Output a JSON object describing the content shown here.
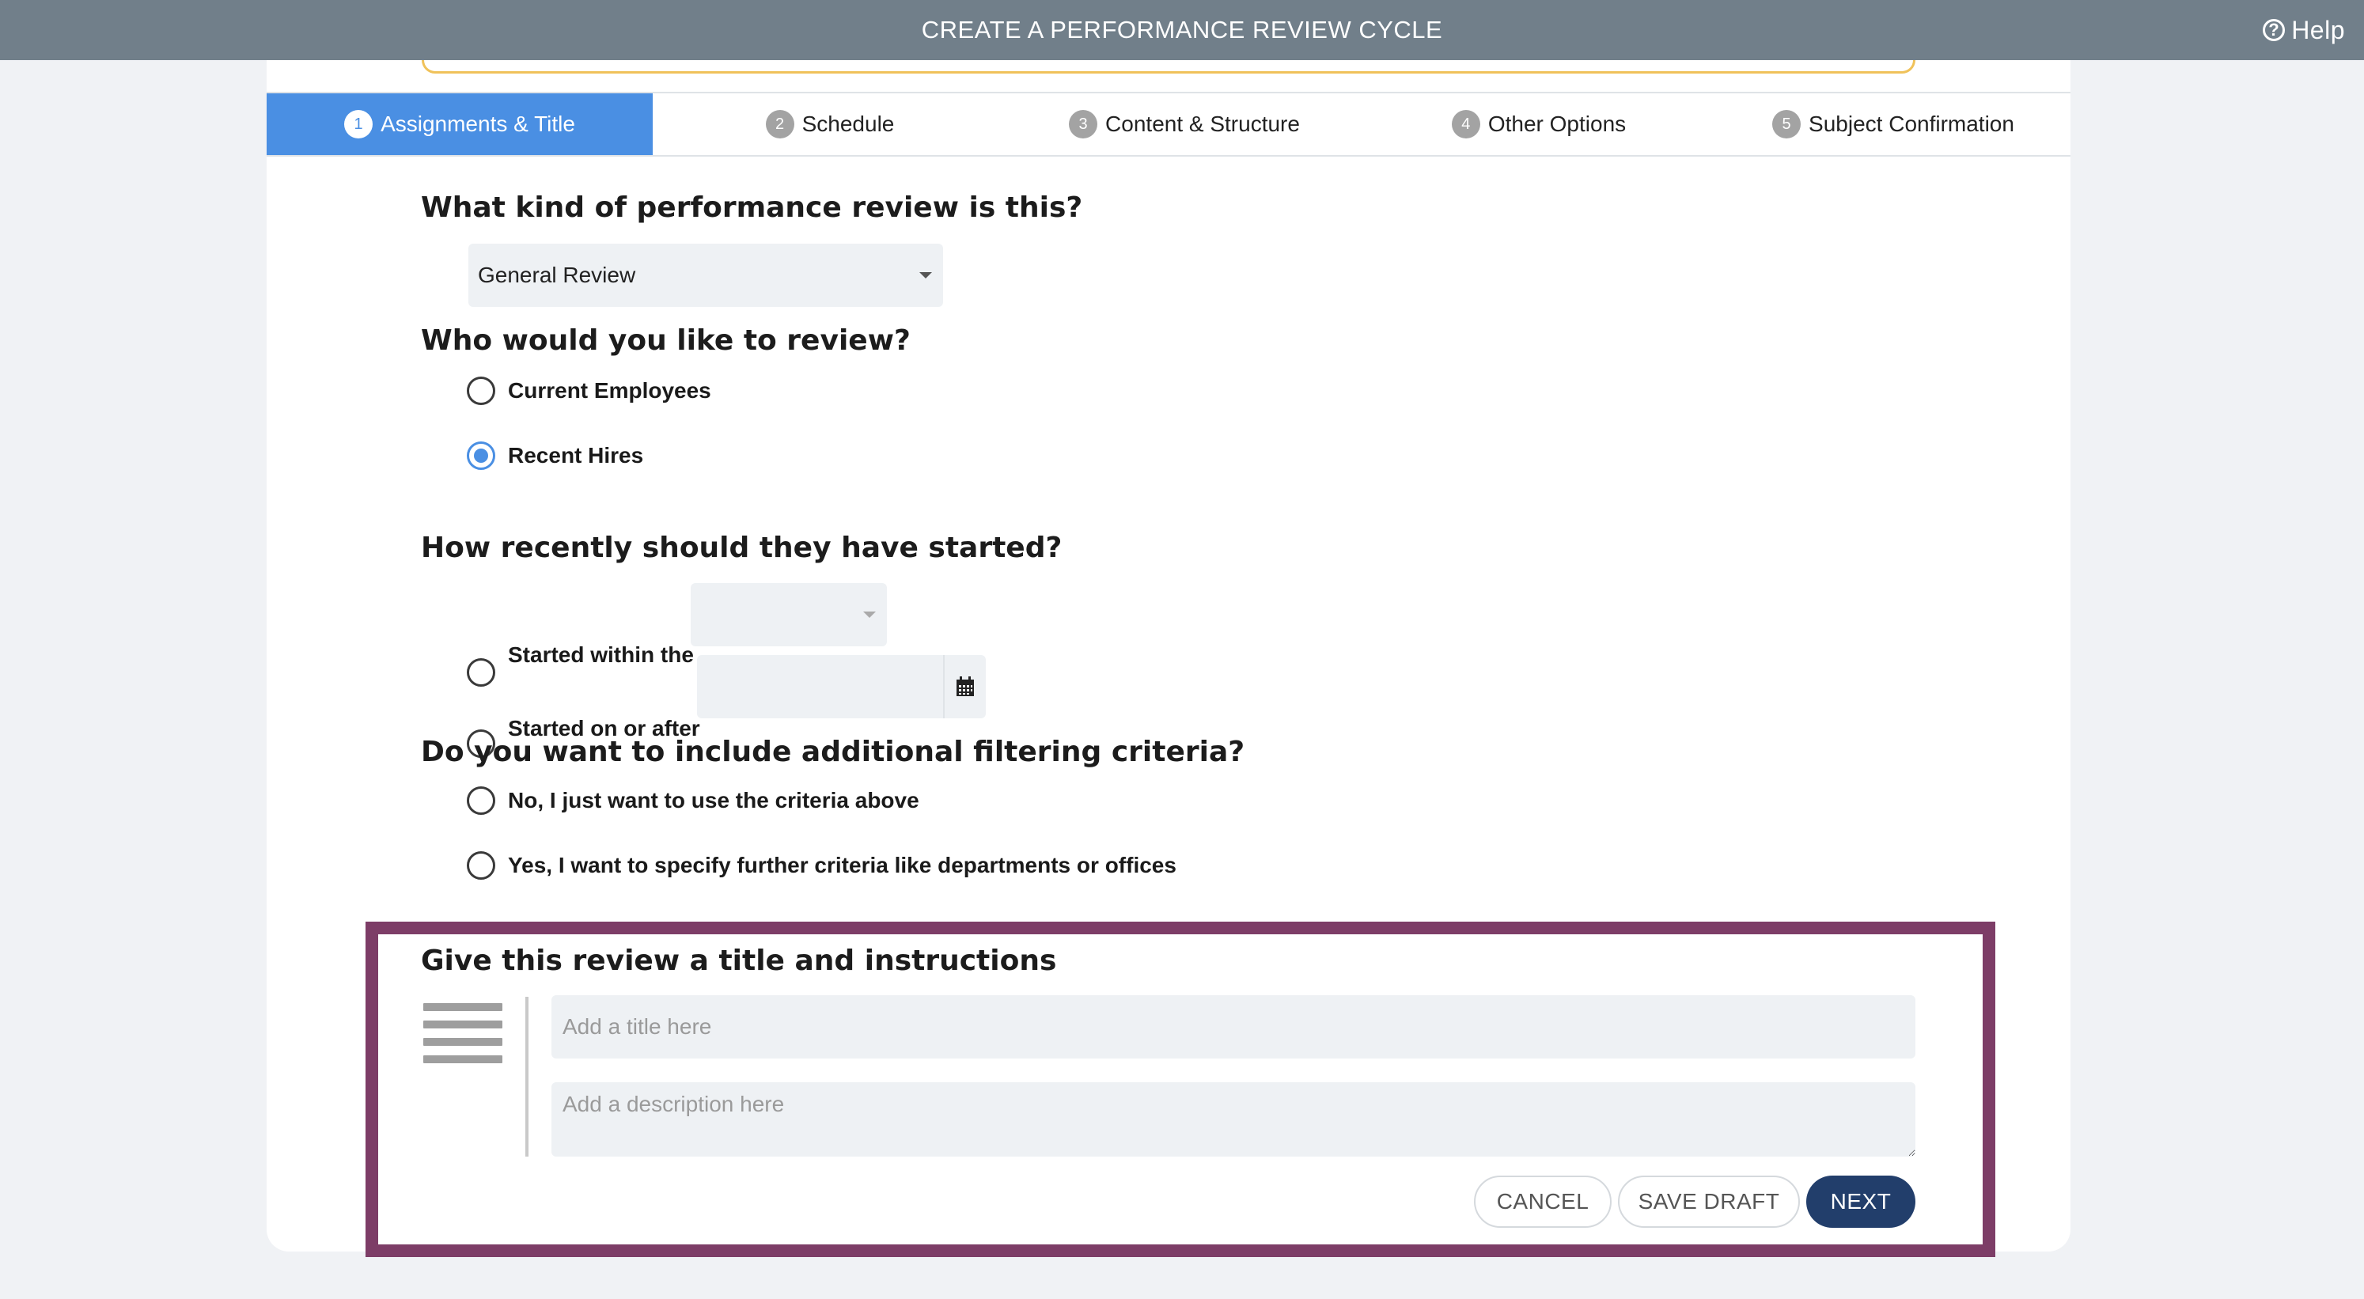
{
  "header": {
    "title": "CREATE A PERFORMANCE REVIEW CYCLE",
    "help_label": "Help",
    "help_icon_glyph": "?"
  },
  "tabs": [
    {
      "num": "1",
      "label": "Assignments & Title",
      "active": true
    },
    {
      "num": "2",
      "label": "Schedule",
      "active": false
    },
    {
      "num": "3",
      "label": "Content & Structure",
      "active": false
    },
    {
      "num": "4",
      "label": "Other Options",
      "active": false
    },
    {
      "num": "5",
      "label": "Subject Confirmation",
      "active": false
    }
  ],
  "review_type": {
    "question": "What kind of performance review is this?",
    "selected": "General Review"
  },
  "who": {
    "question": "Who would you like to review?",
    "options": [
      {
        "label": "Current Employees",
        "checked": false
      },
      {
        "label": "Recent Hires",
        "checked": true
      }
    ]
  },
  "recency": {
    "question": "How recently should they have started?",
    "within_label": "Started within the",
    "within_value": "",
    "after_label": "Started on or after",
    "after_value": ""
  },
  "filtering": {
    "question": "Do you want to include additional filtering criteria?",
    "options": [
      {
        "label": "No, I just want to use the criteria above",
        "checked": false
      },
      {
        "label": "Yes, I want to specify further criteria like departments or offices",
        "checked": false
      }
    ]
  },
  "title_section": {
    "heading": "Give this review a title and instructions",
    "title_placeholder": "Add a title here",
    "title_value": "",
    "description_placeholder": "Add a description here",
    "description_value": ""
  },
  "actions": {
    "cancel": "CANCEL",
    "save_draft": "SAVE DRAFT",
    "next": "NEXT"
  },
  "colors": {
    "accent": "#4a8fe3",
    "header": "#717f8a",
    "highlight_border": "#7d3d67",
    "primary_button": "#223e6b"
  }
}
